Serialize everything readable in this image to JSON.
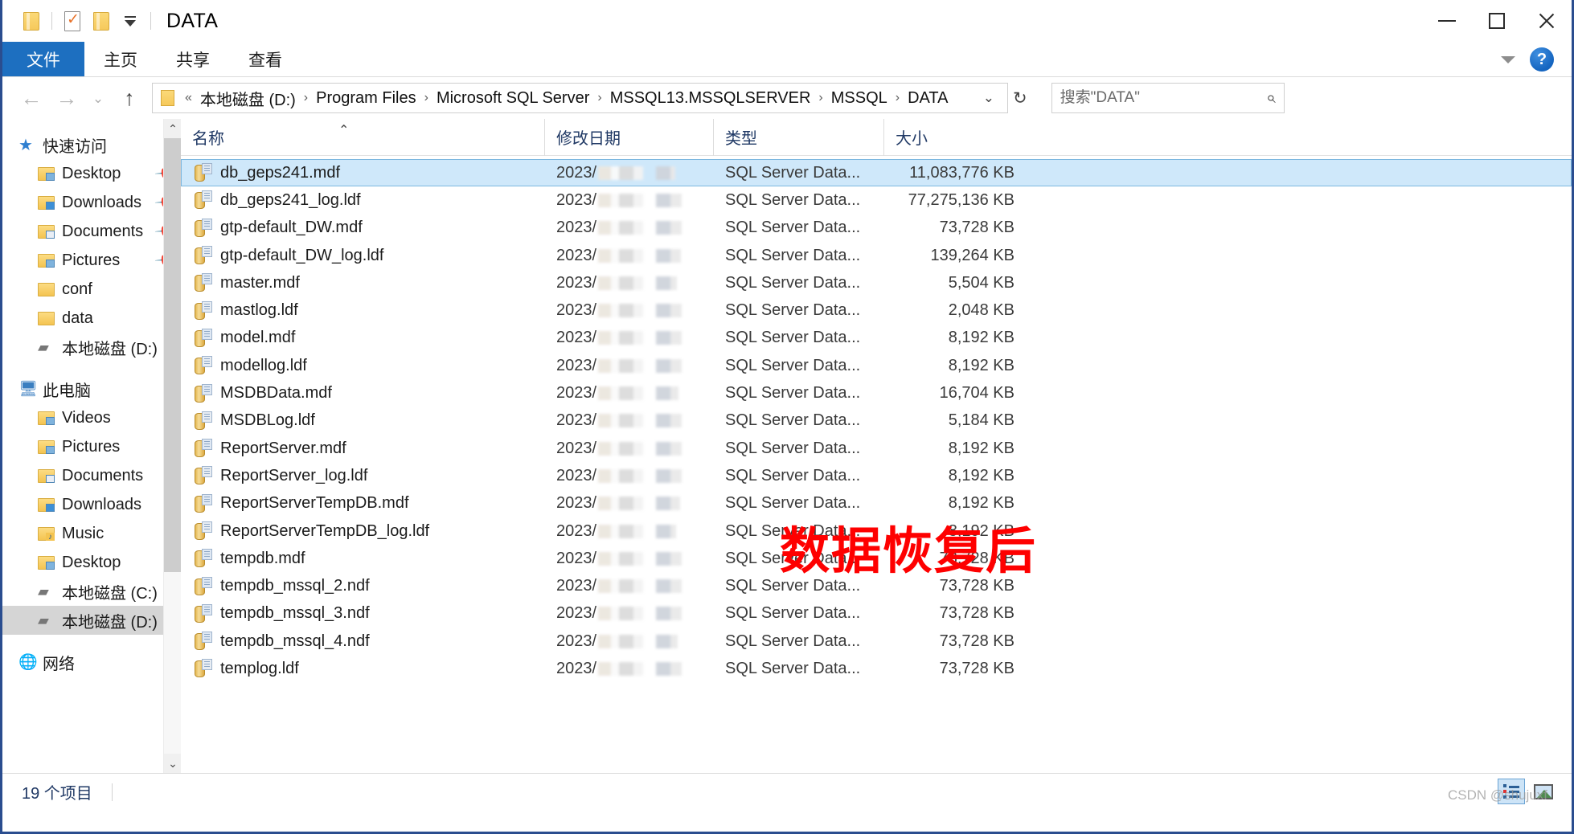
{
  "window": {
    "title": "DATA",
    "quick_access": [
      "folder-icon",
      "properties-icon",
      "new-folder-icon",
      "customize-caret-icon"
    ],
    "controls": {
      "minimize": "minimize-icon",
      "maximize": "maximize-icon",
      "close": "close-icon"
    }
  },
  "ribbon": {
    "tabs": [
      {
        "label": "文件",
        "active": true
      },
      {
        "label": "主页",
        "active": false
      },
      {
        "label": "共享",
        "active": false
      },
      {
        "label": "查看",
        "active": false
      }
    ],
    "collapse_icon": "chevron-down-icon",
    "help_label": "?"
  },
  "address": {
    "back_icon": "back-arrow-icon",
    "forward_icon": "forward-arrow-icon",
    "recent_icon": "chevron-down-icon",
    "up_icon": "up-arrow-icon",
    "overflow": "«",
    "crumbs": [
      "本地磁盘 (D:)",
      "Program Files",
      "Microsoft SQL Server",
      "MSSQL13.MSSQLSERVER",
      "MSSQL",
      "DATA"
    ],
    "dropdown_icon": "chevron-down-icon",
    "refresh_icon": "refresh-icon"
  },
  "search": {
    "placeholder": "搜索\"DATA\"",
    "value": "",
    "icon": "search-icon"
  },
  "sidebar": {
    "groups": [
      {
        "label": "快速访问",
        "icon": "star-pin-icon",
        "items": [
          {
            "label": "Desktop",
            "icon": "folder-desktop-icon",
            "pinned": true
          },
          {
            "label": "Downloads",
            "icon": "folder-downloads-icon",
            "pinned": true
          },
          {
            "label": "Documents",
            "icon": "folder-documents-icon",
            "pinned": true
          },
          {
            "label": "Pictures",
            "icon": "folder-pictures-icon",
            "pinned": true
          },
          {
            "label": "conf",
            "icon": "folder-icon",
            "pinned": false
          },
          {
            "label": "data",
            "icon": "folder-icon",
            "pinned": false
          },
          {
            "label": "本地磁盘 (D:)",
            "icon": "drive-icon",
            "pinned": false
          }
        ]
      },
      {
        "label": "此电脑",
        "icon": "this-pc-icon",
        "items": [
          {
            "label": "Videos",
            "icon": "folder-videos-icon",
            "pinned": false
          },
          {
            "label": "Pictures",
            "icon": "folder-pictures-icon",
            "pinned": false
          },
          {
            "label": "Documents",
            "icon": "folder-documents-icon",
            "pinned": false
          },
          {
            "label": "Downloads",
            "icon": "folder-downloads-icon",
            "pinned": false
          },
          {
            "label": "Music",
            "icon": "folder-music-icon",
            "pinned": false
          },
          {
            "label": "Desktop",
            "icon": "folder-desktop-icon",
            "pinned": false
          },
          {
            "label": "本地磁盘 (C:)",
            "icon": "drive-icon",
            "pinned": false
          },
          {
            "label": "本地磁盘 (D:)",
            "icon": "drive-icon",
            "pinned": false,
            "selected": true
          }
        ]
      },
      {
        "label": "网络",
        "icon": "network-icon",
        "items": []
      }
    ],
    "scroll_up_icon": "scroll-up-icon",
    "scroll_down_icon": "scroll-down-icon"
  },
  "file_list": {
    "columns": [
      "名称",
      "修改日期",
      "类型",
      "大小"
    ],
    "sort_column": "名称",
    "sort_direction": "ascending",
    "date_prefix": "2023/",
    "rows": [
      {
        "name": "db_geps241.mdf",
        "date": "2023/",
        "type": "SQL Server Data...",
        "size": "11,083,776 KB",
        "selected": true
      },
      {
        "name": "db_geps241_log.ldf",
        "date": "2023/",
        "type": "SQL Server Data...",
        "size": "77,275,136 KB",
        "selected": false
      },
      {
        "name": "gtp-default_DW.mdf",
        "date": "2023/",
        "type": "SQL Server Data...",
        "size": "73,728 KB",
        "selected": false
      },
      {
        "name": "gtp-default_DW_log.ldf",
        "date": "2023/",
        "type": "SQL Server Data...",
        "size": "139,264 KB",
        "selected": false
      },
      {
        "name": "master.mdf",
        "date": "2023/",
        "type": "SQL Server Data...",
        "size": "5,504 KB",
        "selected": false
      },
      {
        "name": "mastlog.ldf",
        "date": "2023/",
        "type": "SQL Server Data...",
        "size": "2,048 KB",
        "selected": false
      },
      {
        "name": "model.mdf",
        "date": "2023/",
        "type": "SQL Server Data...",
        "size": "8,192 KB",
        "selected": false
      },
      {
        "name": "modellog.ldf",
        "date": "2023/",
        "type": "SQL Server Data...",
        "size": "8,192 KB",
        "selected": false
      },
      {
        "name": "MSDBData.mdf",
        "date": "2023/",
        "type": "SQL Server Data...",
        "size": "16,704 KB",
        "selected": false
      },
      {
        "name": "MSDBLog.ldf",
        "date": "2023/",
        "type": "SQL Server Data...",
        "size": "5,184 KB",
        "selected": false
      },
      {
        "name": "ReportServer.mdf",
        "date": "2023/",
        "type": "SQL Server Data...",
        "size": "8,192 KB",
        "selected": false
      },
      {
        "name": "ReportServer_log.ldf",
        "date": "2023/",
        "type": "SQL Server Data...",
        "size": "8,192 KB",
        "selected": false
      },
      {
        "name": "ReportServerTempDB.mdf",
        "date": "2023/",
        "type": "SQL Server Data...",
        "size": "8,192 KB",
        "selected": false
      },
      {
        "name": "ReportServerTempDB_log.ldf",
        "date": "2023/",
        "type": "SQL Server Data...",
        "size": "8,192 KB",
        "selected": false
      },
      {
        "name": "tempdb.mdf",
        "date": "2023/",
        "type": "SQL Server Data...",
        "size": "73,728 KB",
        "selected": false
      },
      {
        "name": "tempdb_mssql_2.ndf",
        "date": "2023/",
        "type": "SQL Server Data...",
        "size": "73,728 KB",
        "selected": false
      },
      {
        "name": "tempdb_mssql_3.ndf",
        "date": "2023/",
        "type": "SQL Server Data...",
        "size": "73,728 KB",
        "selected": false
      },
      {
        "name": "tempdb_mssql_4.ndf",
        "date": "2023/",
        "type": "SQL Server Data...",
        "size": "73,728 KB",
        "selected": false
      },
      {
        "name": "templog.ldf",
        "date": "2023/",
        "type": "SQL Server Data...",
        "size": "73,728 KB",
        "selected": false
      }
    ]
  },
  "annotation": {
    "text": "数据恢复后",
    "color": "#fe0000"
  },
  "status": {
    "item_count": "19 个项目",
    "view_details_icon": "details-view-icon",
    "view_thumbnails_icon": "thumbnails-view-icon"
  },
  "watermark": {
    "text": "CSDN @shujuxf"
  }
}
